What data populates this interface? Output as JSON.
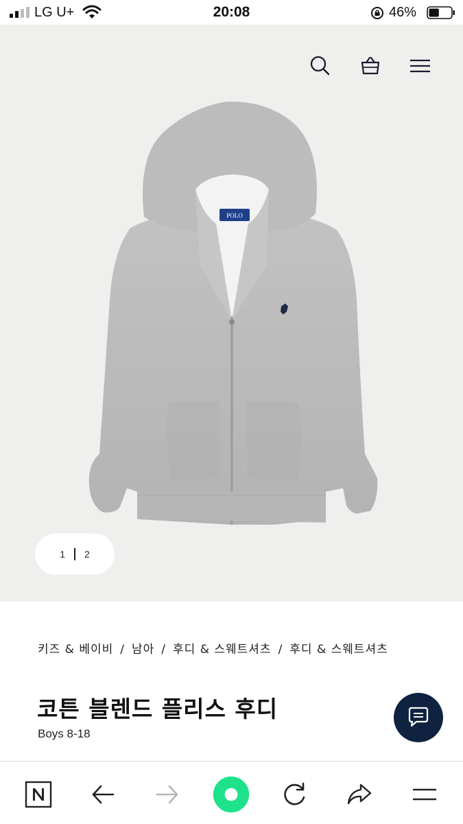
{
  "status_bar": {
    "carrier": "LG U+",
    "time": "20:08",
    "battery_percent": "46%",
    "battery_level": 0.46
  },
  "header": {
    "icons": [
      "search-icon",
      "shopping-bag-icon",
      "hamburger-menu-icon"
    ]
  },
  "gallery": {
    "image_alt": "hoodie-product-image",
    "pager": {
      "current": "1",
      "total": "2"
    }
  },
  "product": {
    "breadcrumb": [
      "키즈 & 베이비",
      "남아",
      "후디 & 스웨트셔츠",
      "후디 & 스웨트셔츠"
    ],
    "breadcrumb_divider": "/",
    "title": "코튼 블렌드 플리스 후디",
    "subtitle": "Boys 8-18"
  },
  "chat": {
    "icon": "chat-bubble-icon"
  },
  "toolbar": {
    "icons": [
      "naver-n-icon",
      "back-arrow-icon",
      "forward-arrow-icon",
      "home-circle-icon",
      "reload-icon",
      "share-icon",
      "menu-icon"
    ]
  },
  "colors": {
    "hero_background": "#efefee",
    "chat_button": "#0f2340",
    "home_button": "#1ee28a",
    "hoodie_gray": "#b9b9b9"
  }
}
